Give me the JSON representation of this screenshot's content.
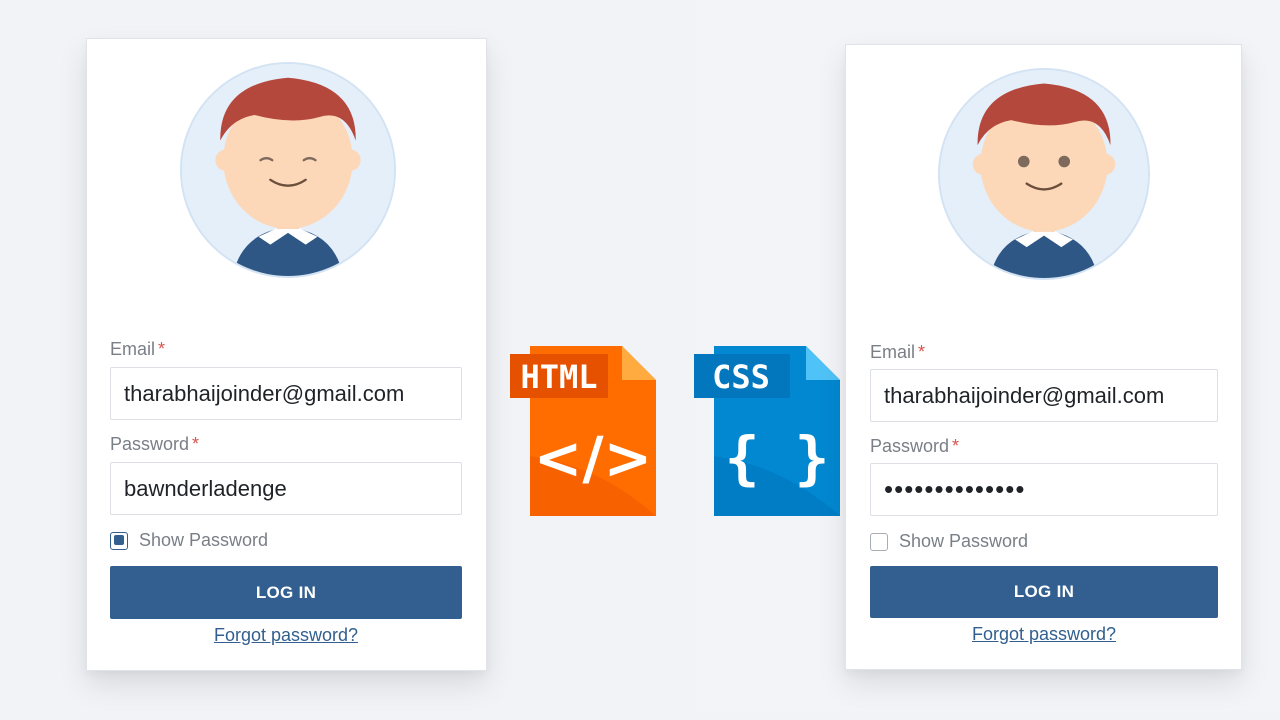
{
  "left_form": {
    "email_label": "Email",
    "required_mark": "*",
    "email_value": "tharabhaijoinder@gmail.com",
    "password_label": "Password",
    "password_value": "bawnderladenge",
    "show_password_label": "Show Password",
    "show_password_checked": true,
    "login_label": "LOG IN",
    "forgot_label": "Forgot password?",
    "avatar_expression": "eyes-closed"
  },
  "right_form": {
    "email_label": "Email",
    "required_mark": "*",
    "email_value": "tharabhaijoinder@gmail.com",
    "password_label": "Password",
    "password_value": "••••••••••••••",
    "show_password_label": "Show Password",
    "show_password_checked": false,
    "login_label": "LOG IN",
    "forgot_label": "Forgot password?",
    "avatar_expression": "eyes-open"
  },
  "badges": {
    "html_label": "HTML",
    "html_symbol": "</>",
    "css_label": "CSS",
    "css_symbol": "{ }"
  },
  "colors": {
    "primary": "#325f8f",
    "required": "#d9534f",
    "html_orange": "#ff6d00",
    "css_blue": "#0288d1"
  }
}
